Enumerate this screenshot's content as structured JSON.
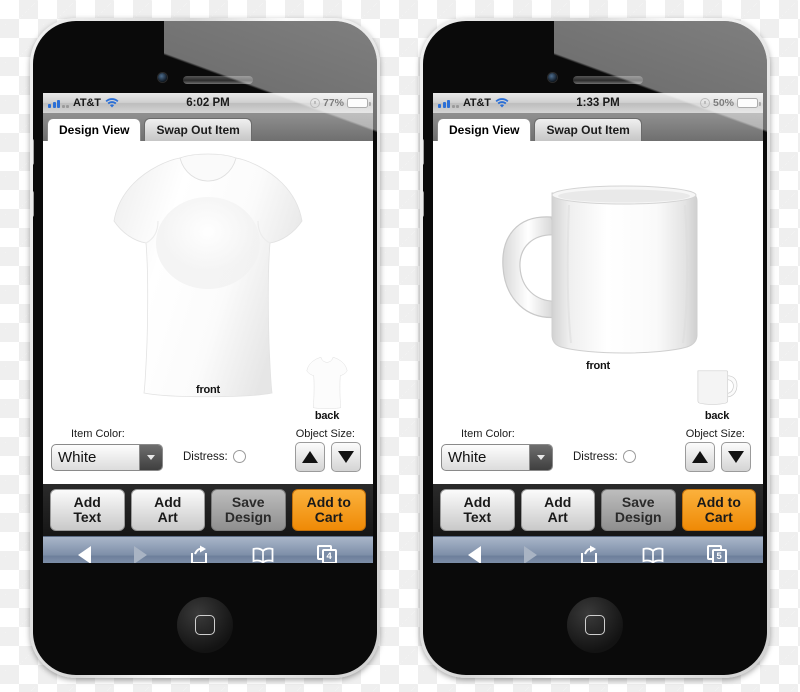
{
  "phones": [
    {
      "id": "phone-left",
      "status": {
        "carrier": "AT&T",
        "time": "6:02 PM",
        "battery_pct": "77%",
        "battery_level": 77
      },
      "tabs": [
        {
          "label": "Design View",
          "active": true
        },
        {
          "label": "Swap Out Item",
          "active": false
        }
      ],
      "product": {
        "type": "tshirt",
        "front_label": "front",
        "back_label": "back"
      },
      "options": {
        "item_color_label": "Item Color:",
        "item_color_value": "White",
        "distress_label": "Distress:",
        "distress_checked": false,
        "object_size_label": "Object Size:",
        "increase_icon": "triangle-up-icon",
        "decrease_icon": "triangle-down-icon"
      },
      "actions": [
        {
          "label": "Add\nText",
          "line1": "Add",
          "line2": "Text",
          "style": "light"
        },
        {
          "label": "Add\nArt",
          "line1": "Add",
          "line2": "Art",
          "style": "light"
        },
        {
          "label": "Save\nDesign",
          "line1": "Save",
          "line2": "Design",
          "style": "dim"
        },
        {
          "label": "Add to\nCart",
          "line1": "Add to",
          "line2": "Cart",
          "style": "cart"
        }
      ],
      "safari": {
        "back_icon": "back-arrow-icon",
        "forward_icon": "forward-arrow-icon",
        "share_icon": "share-icon",
        "bookmarks_icon": "bookmarks-book-icon",
        "tabs_icon": "tabs-icon",
        "tab_count": "4"
      }
    },
    {
      "id": "phone-right",
      "status": {
        "carrier": "AT&T",
        "time": "1:33 PM",
        "battery_pct": "50%",
        "battery_level": 50
      },
      "tabs": [
        {
          "label": "Design View",
          "active": true
        },
        {
          "label": "Swap Out Item",
          "active": false
        }
      ],
      "product": {
        "type": "mug",
        "front_label": "front",
        "back_label": "back"
      },
      "options": {
        "item_color_label": "Item Color:",
        "item_color_value": "White",
        "distress_label": "Distress:",
        "distress_checked": false,
        "object_size_label": "Object Size:",
        "increase_icon": "triangle-up-icon",
        "decrease_icon": "triangle-down-icon"
      },
      "actions": [
        {
          "label": "Add\nText",
          "line1": "Add",
          "line2": "Text",
          "style": "light"
        },
        {
          "label": "Add\nArt",
          "line1": "Add",
          "line2": "Art",
          "style": "light"
        },
        {
          "label": "Save\nDesign",
          "line1": "Save",
          "line2": "Design",
          "style": "dim"
        },
        {
          "label": "Add to\nCart",
          "line1": "Add to",
          "line2": "Cart",
          "style": "cart"
        }
      ],
      "safari": {
        "back_icon": "back-arrow-icon",
        "forward_icon": "forward-arrow-icon",
        "share_icon": "share-icon",
        "bookmarks_icon": "bookmarks-book-icon",
        "tabs_icon": "tabs-icon",
        "tab_count": "5"
      }
    }
  ],
  "colors": {
    "accent_orange": "#ef8a06",
    "signal_blue": "#2b6fd6",
    "battery_green": "#4da81e",
    "toolbar_blue": "#7d8ea8"
  }
}
